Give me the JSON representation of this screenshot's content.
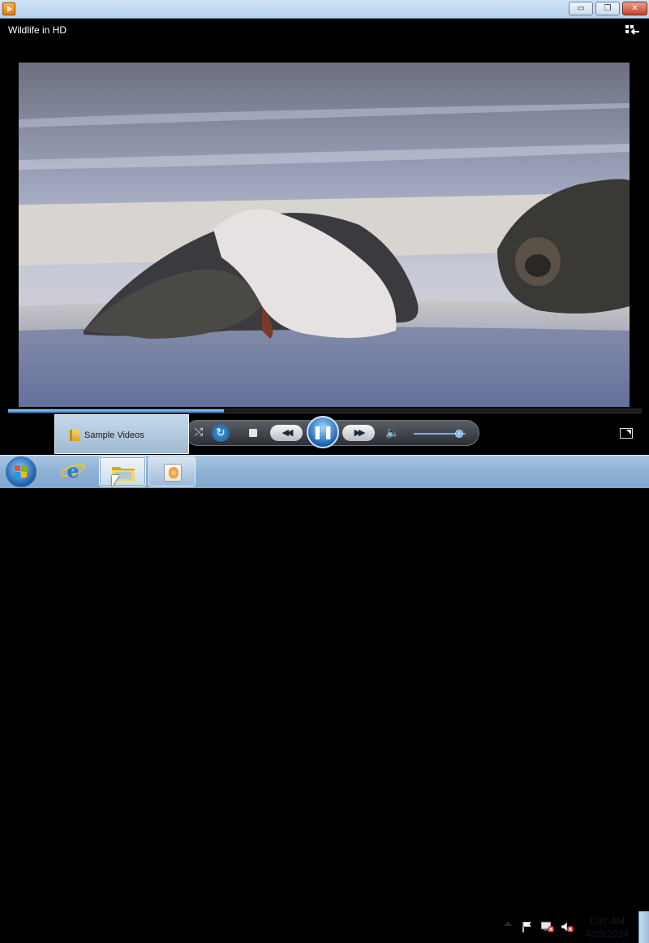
{
  "window": {
    "title": "",
    "minimize_label": "▭",
    "maximize_label": "❐",
    "close_label": "✕"
  },
  "player": {
    "media_title": "Wildlife in HD",
    "switch_to_library_icon": "switch-to-library-icon",
    "seek_progress": 0.34,
    "volume_level": 0.88,
    "state": "playing",
    "controls": {
      "shuffle_glyph": "⤭",
      "repeat_glyph": "↻",
      "previous_glyph": "◀◀",
      "pause_glyph": "❚❚",
      "next_glyph": "▶▶",
      "mute_glyph": "🔈"
    }
  },
  "jump_list": {
    "items": [
      {
        "label": "Sample Videos",
        "icon": "folder-icon"
      }
    ]
  },
  "taskbar": {
    "apps": [
      {
        "name": "Internet Explorer",
        "icon": "internet-explorer-icon"
      },
      {
        "name": "Windows Explorer",
        "icon": "folder-icon",
        "active": true
      },
      {
        "name": "Windows Media Player",
        "icon": "media-player-icon"
      }
    ],
    "clock": {
      "time": "1:07 AM",
      "date": "4/28/2024"
    }
  },
  "colors": {
    "accent": "#2f7cd1",
    "taskbar": "#8fb3d6",
    "player_bg": "#000000"
  }
}
